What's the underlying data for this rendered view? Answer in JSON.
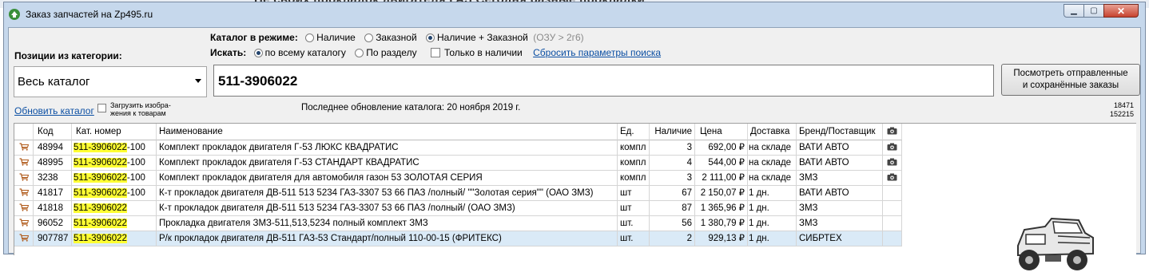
{
  "background_text": "Не своих прокладок двигателя ГАЗ  Сегодня разные прокладки",
  "window": {
    "title": "Заказ запчастей на Zp495.ru",
    "caption_buttons": {
      "minimize": "▁",
      "maximize": "▢",
      "close": "✕"
    }
  },
  "category": {
    "label": "Позиции из категории:",
    "selected": "Весь каталог",
    "refresh_link": "Обновить каталог",
    "load_images_label_line1": "Загрузить изобра-",
    "load_images_label_line2": "жения к товарам",
    "load_images_checked": false
  },
  "mode": {
    "label": "Каталог в режиме:",
    "options": [
      "Наличие",
      "Заказной",
      "Наличие + Заказной"
    ],
    "selected": "Наличие + Заказной",
    "note": "(ОЗУ > 2г6)"
  },
  "search_scope": {
    "label": "Искать:",
    "options": [
      "по всему каталогу",
      "По разделу"
    ],
    "selected": "по всему каталогу",
    "in_stock_only_label": "Только в наличии",
    "in_stock_only_checked": false,
    "reset_link": "Сбросить параметры поиска"
  },
  "search": {
    "value": "511-3906022"
  },
  "orders_button": {
    "line1": "Посмотреть отправленные",
    "line2": "и сохранённые заказы"
  },
  "status": {
    "last_update_label": "Последнее обновление каталога:",
    "last_update_value": "20 ноября 2019 г.",
    "count1": "18471",
    "count2": "152215"
  },
  "table": {
    "columns": [
      "Код",
      "Кат. номер",
      "Наименование",
      "Ед.",
      "Наличие",
      "Цена",
      "Доставка",
      "Бренд/Поставщик"
    ],
    "rows": [
      {
        "code": "48994",
        "cat_hl": "511-3906022",
        "cat_rest": "-100",
        "name": "Комплект прокладок двигателя Г-53 ЛЮКС КВАДРАТИС",
        "unit": "компл",
        "stock": "3",
        "price": "692,00 ₽",
        "delivery": "на складе",
        "brand": "ВАТИ АВТО",
        "photo": true
      },
      {
        "code": "48995",
        "cat_hl": "511-3906022",
        "cat_rest": "-100",
        "name": "Комплект прокладок двигателя Г-53 СТАНДАРТ  КВАДРАТИС",
        "unit": "компл",
        "stock": "4",
        "price": "544,00 ₽",
        "delivery": "на складе",
        "brand": "ВАТИ АВТО",
        "photo": true
      },
      {
        "code": "3238",
        "cat_hl": "511-3906022",
        "cat_rest": "-100",
        "name": "Комплект прокладок двигателя для автомобиля газон 53 ЗОЛОТАЯ СЕРИЯ",
        "unit": "компл",
        "stock": "3",
        "price": "2 111,00 ₽",
        "delivery": "на складе",
        "brand": "ЗМЗ",
        "photo": true
      },
      {
        "code": "41817",
        "cat_hl": "511-3906022",
        "cat_rest": "-100",
        "name": "К-т прокладок двигателя ДВ-511 513 5234 ГАЗ-3307 53 66 ПАЗ /полный/ \"\"Золотая серия\"\" (ОАО ЗМЗ)",
        "unit": "шт",
        "stock": "67",
        "price": "2 150,07 ₽",
        "delivery": "1 дн.",
        "brand": "ВАТИ АВТО",
        "photo": false
      },
      {
        "code": "41818",
        "cat_hl": "511-3906022",
        "cat_rest": "",
        "name": "К-т прокладок двигателя ДВ-511 513 5234 ГАЗ-3307 53 66 ПАЗ /полный/ (ОАО ЗМЗ)",
        "unit": "шт",
        "stock": "87",
        "price": "1 365,96 ₽",
        "delivery": "1 дн.",
        "brand": "ЗМЗ",
        "photo": false
      },
      {
        "code": "96052",
        "cat_hl": "511-3906022",
        "cat_rest": "",
        "name": "Прокладка двигателя ЗМЗ-511,513,5234 полный комплект ЗМЗ",
        "unit": "шт.",
        "stock": "56",
        "price": "1 380,79 ₽",
        "delivery": "1 дн.",
        "brand": "ЗМЗ",
        "photo": false
      },
      {
        "code": "907787",
        "cat_hl": "511-3906022",
        "cat_rest": "",
        "name": "Р/к прокладок двигателя ДВ-511 ГАЗ-53 Стандарт/полный 110-00-15 (ФРИТЕКС)",
        "unit": "шт.",
        "stock": "2",
        "price": "929,13 ₽",
        "delivery": "1 дн.",
        "brand": "СИБРТЕХ",
        "photo": false,
        "selected": true
      }
    ]
  }
}
